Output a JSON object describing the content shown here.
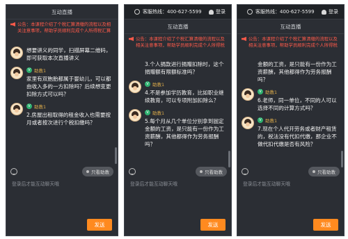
{
  "title": "互动直播",
  "notice": "公告：本课程介绍了个税汇算清缴的流程以及相关注意事项，帮助学员顺利完成个人所得税汇算清缴",
  "hotline": {
    "label": "客服热线：400-627-5599",
    "login": "登录"
  },
  "bottom": {
    "only": "只看助教",
    "placeholder": "登录后才能互动聊天哦",
    "send": "发送"
  },
  "panel1": {
    "messages": [
      {
        "name": "",
        "text": "想要讲义的同学，扫描屏幕二维码，即可获取本次直播讲义"
      },
      {
        "name": "助教1",
        "text": "家里有双胞胎都属于婴幼儿，可以都由收入多的一方扣除吗？后续想变更扣除方式可以吗？"
      },
      {
        "name": "助教1",
        "text": "2.房屋出租取得的租金收入也需要按月或者按次进行个税扣缴吗？"
      }
    ]
  },
  "panel2": {
    "messages": [
      {
        "name": "",
        "text": "3.个人捐款进行捐赠扣除时，这个捐赠额有限额标准吗？"
      },
      {
        "name": "助教1",
        "text": "4.不是参加学历教育，比如职业继续教育，可以专项附加扣除么？"
      },
      {
        "name": "助教1",
        "text": "5.每个月从几个单位分别拿到固定金额的工资，是只能有一份作为工资薪酬，其他都得作为劳务报酬吗？"
      }
    ]
  },
  "panel3": {
    "messages": [
      {
        "name": "",
        "text": "金额的工资，是只能有一份作为工资薪酬，其他都得作为劳务报酬吗？"
      },
      {
        "name": "助教1",
        "text": "6.老师，同一单位，不同的人可以选择不同的计算方式吗？"
      },
      {
        "name": "助教1",
        "text": "7.现在个人代开劳务或者财产租赁的，税法没有代扣代缴，那企业不做代扣代缴是否有风险？"
      }
    ]
  }
}
